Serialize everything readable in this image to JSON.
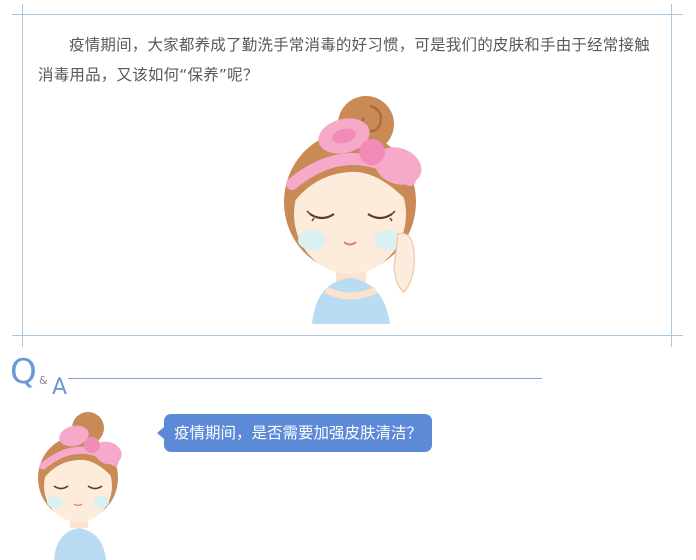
{
  "intro": {
    "paragraph": "疫情期间，大家都养成了勤洗手常消毒的好习惯，可是我们的皮肤和手由于经常接触消毒用品，又该如何“保养”呢？"
  },
  "qa_heading": {
    "q": "Q",
    "amp": "&",
    "a": "A"
  },
  "question_bubble": {
    "text": "疫情期间，是否需要加强皮肤清洁？"
  },
  "colors": {
    "frame": "#a9c9e3",
    "accent_blue": "#5c8ad6",
    "text_gray": "#595959",
    "bow_pink": "#f6a9c9",
    "hair_brown": "#c98a55"
  }
}
